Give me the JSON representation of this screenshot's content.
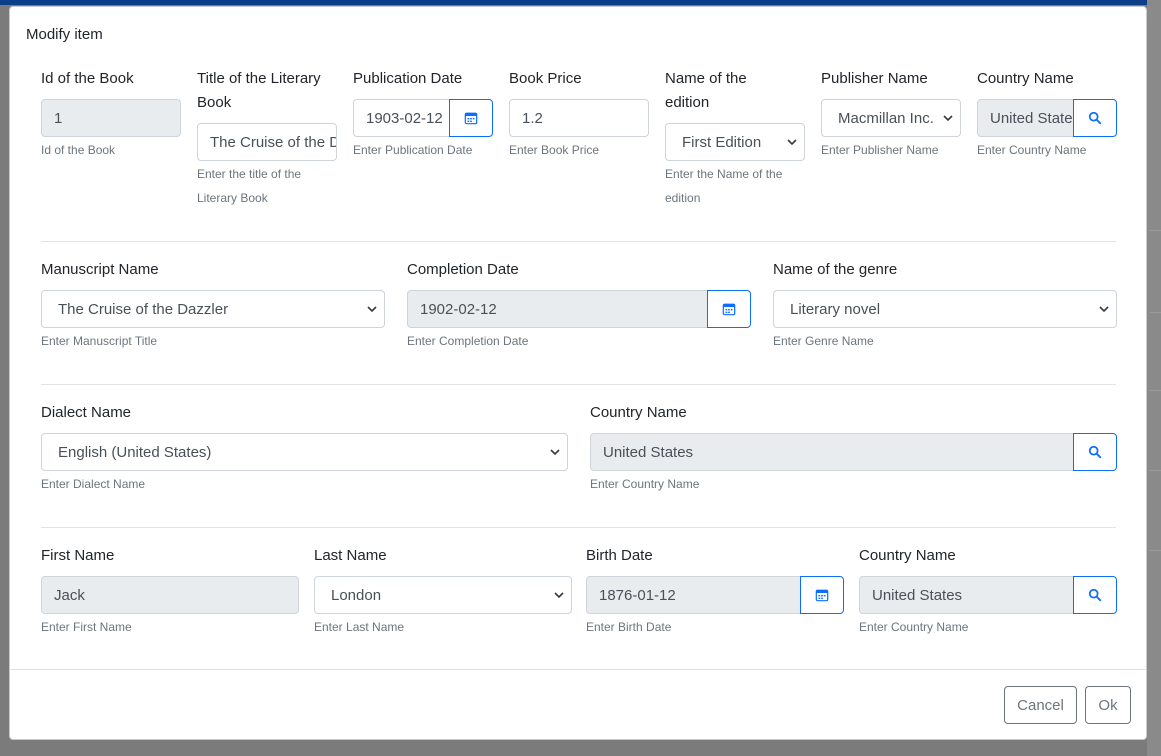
{
  "modal": {
    "title": "Modify item"
  },
  "row1": {
    "book_id": {
      "label": "Id of the Book",
      "value": "1",
      "hint": "Id of the Book"
    },
    "title": {
      "label": "Title of the Literary Book",
      "value": "The Cruise of the Dazzler",
      "hint": "Enter the title of the Literary Book"
    },
    "publication_date": {
      "label": "Publication Date",
      "value": "1903-02-12",
      "hint": "Enter Publication Date"
    },
    "price": {
      "label": "Book Price",
      "value": "1.2",
      "hint": "Enter Book Price"
    },
    "edition": {
      "label": "Name of the edition",
      "value": "First Edition",
      "hint": "Enter the Name of the edition"
    },
    "publisher": {
      "label": "Publisher Name",
      "value": "Macmillan Inc.",
      "hint": "Enter Publisher Name"
    },
    "country": {
      "label": "Country Name",
      "value": "United States",
      "hint": "Enter Country Name"
    }
  },
  "row2": {
    "manuscript": {
      "label": "Manuscript Name",
      "value": "The Cruise of the Dazzler",
      "hint": "Enter Manuscript Title"
    },
    "completion_date": {
      "label": "Completion Date",
      "value": "1902-02-12",
      "hint": "Enter Completion Date"
    },
    "genre": {
      "label": "Name of the genre",
      "value": "Literary novel",
      "hint": "Enter Genre Name"
    }
  },
  "row3": {
    "dialect": {
      "label": "Dialect Name",
      "value": "English (United States)",
      "hint": "Enter Dialect Name"
    },
    "country": {
      "label": "Country Name",
      "value": "United States",
      "hint": "Enter Country Name"
    }
  },
  "row4": {
    "first_name": {
      "label": "First Name",
      "value": "Jack",
      "hint": "Enter First Name"
    },
    "last_name": {
      "label": "Last Name",
      "value": "London",
      "hint": "Enter Last Name"
    },
    "birth_date": {
      "label": "Birth Date",
      "value": "1876-01-12",
      "hint": "Enter Birth Date"
    },
    "country": {
      "label": "Country Name",
      "value": "United States",
      "hint": "Enter Country Name"
    }
  },
  "footer": {
    "cancel_label": "Cancel",
    "ok_label": "Ok"
  },
  "icons": {
    "search": "search-icon",
    "calendar": "calendar-icon",
    "dropdown": "chevron-down-icon"
  },
  "colors": {
    "accent": "#0d6efd",
    "readonly_bg": "#e9ecef",
    "topbar": "#0b3f8a"
  }
}
